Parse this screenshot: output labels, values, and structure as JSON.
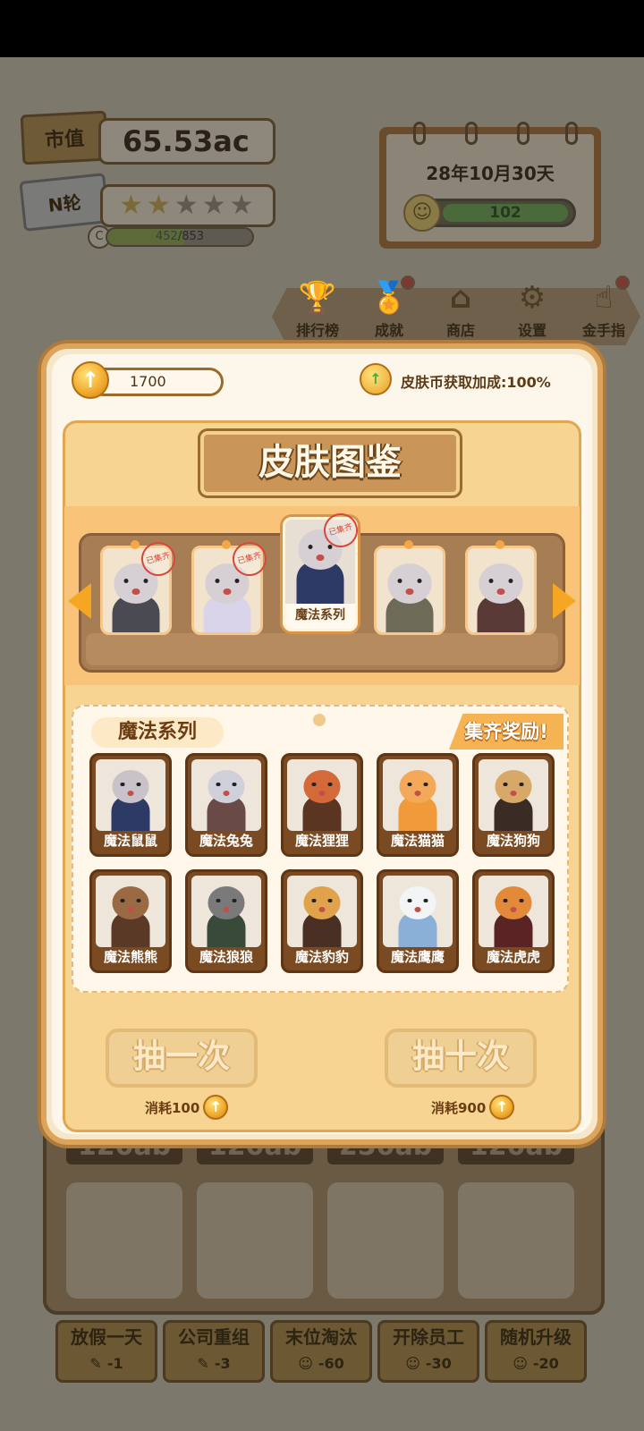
{
  "hud": {
    "market_cap_label": "市值",
    "market_cap_value": "65.53ac",
    "round_label": "N轮",
    "stars_filled": 2,
    "stars_total": 5,
    "rank_letter": "C",
    "progress_current": "452",
    "progress_total": "/853",
    "progress_fraction": 0.53,
    "date": "28年10月30天",
    "mood_value": "102"
  },
  "nav": [
    {
      "label": "排行榜",
      "icon": "trophy-icon",
      "badge": false
    },
    {
      "label": "成就",
      "icon": "medal-icon",
      "badge": true
    },
    {
      "label": "商店",
      "icon": "shop-icon",
      "badge": false
    },
    {
      "label": "设置",
      "icon": "gear-icon",
      "badge": false
    },
    {
      "label": "金手指",
      "icon": "finger-icon",
      "badge": true
    }
  ],
  "underlay": {
    "prices": [
      "120ab",
      "120ab",
      "250ab",
      "120ab"
    ]
  },
  "bottom_actions": [
    {
      "label": "放假一天",
      "cost": "-1"
    },
    {
      "label": "公司重组",
      "cost": "-3"
    },
    {
      "label": "末位淘汰",
      "cost": "-60"
    },
    {
      "label": "开除员工",
      "cost": "-30"
    },
    {
      "label": "随机升级",
      "cost": "-20"
    }
  ],
  "modal": {
    "coins": "1700",
    "bonus_text": "皮肤币获取加成:100%",
    "title": "皮肤图鉴",
    "carousel": [
      {
        "label": "",
        "stamp": "已集齐",
        "selected": false,
        "color": "#4a4a52"
      },
      {
        "label": "",
        "stamp": "已集齐",
        "selected": false,
        "color": "#d9d4ea"
      },
      {
        "label": "魔法系列",
        "stamp": "已集齐",
        "selected": true,
        "color": "#2e3a66"
      },
      {
        "label": "",
        "stamp": "",
        "selected": false,
        "color": "#6e6a58"
      },
      {
        "label": "",
        "stamp": "",
        "selected": false,
        "color": "#5a3a36"
      }
    ],
    "series_name": "魔法系列",
    "reward_label": "集齐奖励!",
    "skins": [
      {
        "name": "魔法鼠鼠",
        "color": "#2e3a66",
        "face": "#c9c3c9"
      },
      {
        "name": "魔法兔兔",
        "color": "#6a4a46",
        "face": "#cfd0da"
      },
      {
        "name": "魔法狸狸",
        "color": "#5a3622",
        "face": "#d46a3a"
      },
      {
        "name": "魔法猫猫",
        "color": "#f09a3a",
        "face": "#f4a85a"
      },
      {
        "name": "魔法狗狗",
        "color": "#3a2c24",
        "face": "#d8a868"
      },
      {
        "name": "魔法熊熊",
        "color": "#5a3a26",
        "face": "#9a6a44"
      },
      {
        "name": "魔法狼狼",
        "color": "#3a4a3a",
        "face": "#7a7a7a"
      },
      {
        "name": "魔法豹豹",
        "color": "#4a3024",
        "face": "#e0a24a"
      },
      {
        "name": "魔法鹰鹰",
        "color": "#8ab0d8",
        "face": "#f2f4f6"
      },
      {
        "name": "魔法虎虎",
        "color": "#5a2424",
        "face": "#e38a3a"
      }
    ],
    "draw_one": "抽一次",
    "draw_ten": "抽十次",
    "cost_one": "消耗100",
    "cost_ten": "消耗900"
  }
}
